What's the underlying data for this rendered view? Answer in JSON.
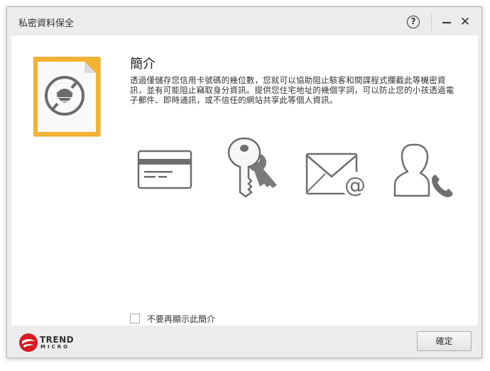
{
  "window": {
    "title": "私密資料保全",
    "help_label": "?",
    "close_label": "✕"
  },
  "intro": {
    "title": "簡介",
    "body": "透過僅儲存您信用卡號碼的幾位數，您就可以協助阻止駭客和間諜程式攔截此等機密資訊，並有可能阻止竊取身分資訊。提供您住宅地址的幾個字詞，可以防止您的小孩透過電子郵件、即時通訊，或不信任的網站共享此等個人資訊。"
  },
  "features": [
    {
      "icon": "credit-card-icon"
    },
    {
      "icon": "keys-icon"
    },
    {
      "icon": "email-icon"
    },
    {
      "icon": "contact-phone-icon"
    }
  ],
  "dont_show": {
    "label": "不要再顯示此簡介",
    "checked": false
  },
  "footer": {
    "brand_line1": "TREND",
    "brand_line2": "MICRO",
    "ok_label": "確定"
  },
  "colors": {
    "accent_orange": "#F4B233",
    "brand_red": "#D71920",
    "icon_gray": "#6e6e6e"
  }
}
